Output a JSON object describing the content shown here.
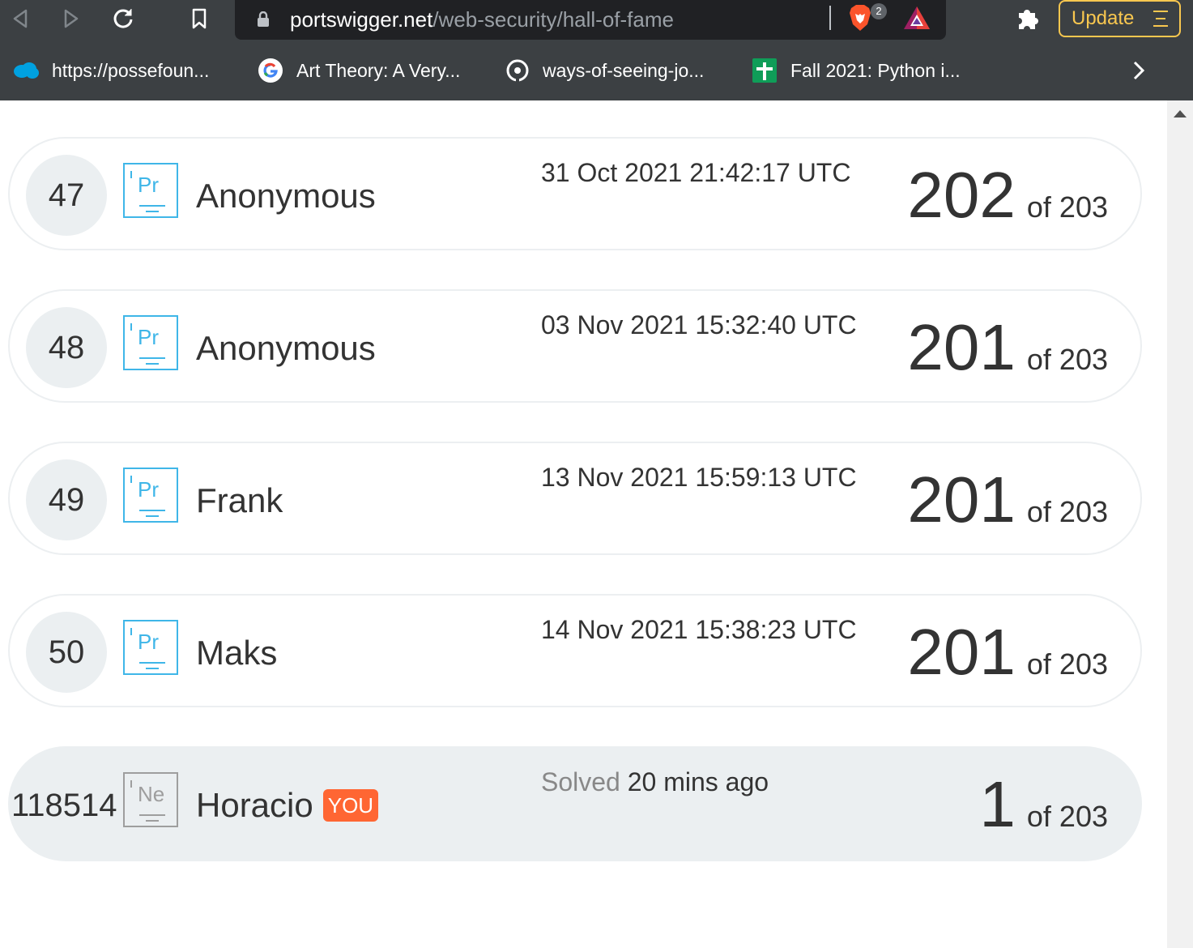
{
  "browser": {
    "url_host": "portswigger.net",
    "url_path": "/web-security/hall-of-fame",
    "brave_shields_count": "2",
    "update_label": "Update",
    "bookmarks": [
      {
        "label": "https://possefoun...",
        "icon": "salesforce-cloud-icon"
      },
      {
        "label": "Art Theory: A Very...",
        "icon": "google-icon"
      },
      {
        "label": "ways-of-seeing-jo...",
        "icon": "github-icon"
      },
      {
        "label": "Fall 2021: Python i...",
        "icon": "google-sheets-icon"
      }
    ]
  },
  "entries": [
    {
      "rank": "47",
      "element": "Pr",
      "name": "Anonymous",
      "timestamp": "31 Oct 2021 21:42:17 UTC",
      "score": "202",
      "total": "of 203"
    },
    {
      "rank": "48",
      "element": "Pr",
      "name": "Anonymous",
      "timestamp": "03 Nov 2021 15:32:40 UTC",
      "score": "201",
      "total": "of 203"
    },
    {
      "rank": "49",
      "element": "Pr",
      "name": "Frank",
      "timestamp": "13 Nov 2021 15:59:13 UTC",
      "score": "201",
      "total": "of 203"
    },
    {
      "rank": "50",
      "element": "Pr",
      "name": "Maks",
      "timestamp": "14 Nov 2021 15:38:23 UTC",
      "score": "201",
      "total": "of 203"
    }
  ],
  "you": {
    "rank": "118514",
    "element": "Ne",
    "name": "Horacio",
    "badge": "YOU",
    "solved_prefix": "Solved",
    "solved_time": "20 mins ago",
    "score": "1",
    "total": "of 203"
  },
  "colors": {
    "accent_blue": "#3fb6e8",
    "you_badge": "#ff6633",
    "update_border": "#f9c74f"
  }
}
